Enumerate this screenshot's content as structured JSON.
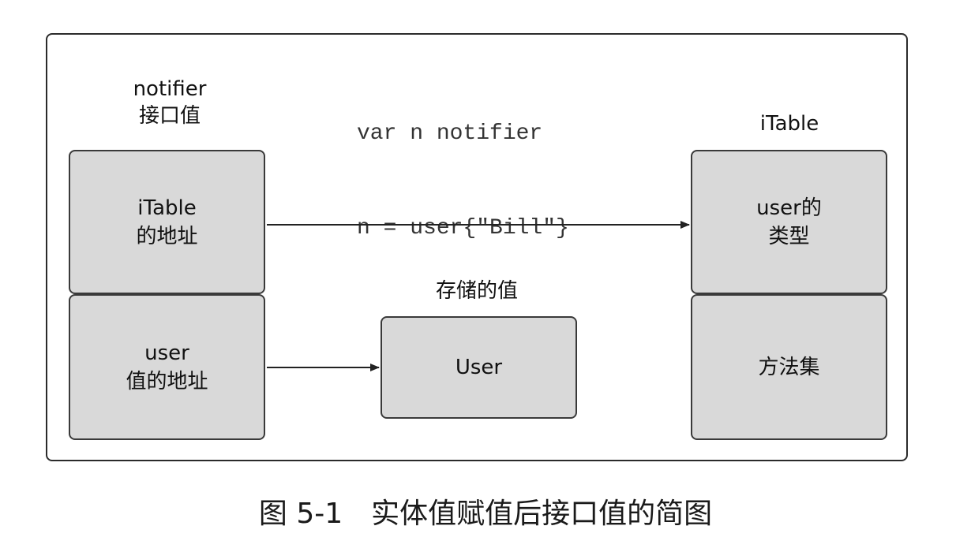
{
  "code": {
    "line1": "var n notifier",
    "line2": "n = user{\"Bill\"}"
  },
  "diagram": {
    "iface_box": {
      "header_line1": "notifier",
      "header_line2": "接口值",
      "cell_top_line1": "iTable",
      "cell_top_line2": "的地址",
      "cell_bottom_line1": "user",
      "cell_bottom_line2": "值的地址"
    },
    "stored_value": {
      "header": "存储的值",
      "label": "User"
    },
    "itable": {
      "header": "iTable",
      "cell_top_line1": "user的",
      "cell_top_line2": "类型",
      "cell_bottom": "方法集"
    }
  },
  "caption": "图 5-1　实体值赋值后接口值的简图",
  "colors": {
    "box_fill": "#d9d9d9",
    "box_border": "#3a3a3a",
    "arrow": "#222222"
  }
}
